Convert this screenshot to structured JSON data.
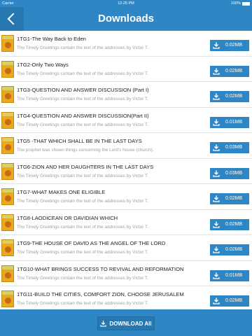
{
  "status_bar": {
    "carrier": "Carrier",
    "time": "12:25 PM",
    "battery": "100%"
  },
  "navbar": {
    "title": "Downloads"
  },
  "items": [
    {
      "title": "1TG1-The Way Back to Eden",
      "subtitle": "The Timely Greetings contain the text of the addresses by Victor T.",
      "size": "0.02MB"
    },
    {
      "title": "1TG2-Only Two Ways",
      "subtitle": "The Timely Greetings contain the text of the addresses by Victor T.",
      "size": "0.02MB"
    },
    {
      "title": "1TG3-QUESTION AND ANSWER DISCUSSION (Part I)",
      "subtitle": "The Timely Greetings contain the text of the addresses by Victor T.",
      "size": "0.02MB"
    },
    {
      "title": "1TG4-QUESTION AND ANSWER DISCUSSION(Part II)",
      "subtitle": "The Timely Greetings contain the text of the addresses by Victor T.",
      "size": "0.01MB"
    },
    {
      "title": "1TG5 -THAT WHICH SHALL BE IN THE LAST DAYS",
      "subtitle": "The prophet was shown things concerning the Lord's house (church).",
      "size": "0.03MB"
    },
    {
      "title": "1TG6-ZION AND HER DAUGHTERS IN THE LAST DAYS",
      "subtitle": "The Timely Greetings contain the text of the addresses by Victor T.",
      "size": "0.03MB"
    },
    {
      "title": "1TG7-WHAT MAKES ONE ELIGIBLE",
      "subtitle": "The Timely Greetings contain the text of the addresses by Victor T.",
      "size": "0.02MB"
    },
    {
      "title": "1TG8-LAODICEAN OR DAVIDIAN WHICH",
      "subtitle": "The Timely Greetings contain the text of the addresses by Victor T.",
      "size": "0.02MB"
    },
    {
      "title": "1TG9-THE HOUSE OF DAVID AS THE ANGEL OF THE LORD",
      "subtitle": "The Timely Greetings contain the text of the addresses by Victor T.",
      "size": "0.02MB"
    },
    {
      "title": "1TG10-WHAT BRINGS SUCCESS TO REVIVAL AND REFORMATION",
      "subtitle": "The Timely Greetings contain the text of the addresses by Victor T.",
      "size": "0.01MB"
    },
    {
      "title": "1TG11-BUILD THE CITIES, COMFORT ZION, CHOOSE JERUSALEM",
      "subtitle": "The Timely Greetings contain the text of the addresses by Victor T.",
      "size": "0.02MB"
    }
  ],
  "footer": {
    "download_all_label": "DOWNLOAD All"
  },
  "colors": {
    "primary": "#2f86c4",
    "primary_dark": "#2777b0",
    "thumb": "#e9a91f"
  }
}
